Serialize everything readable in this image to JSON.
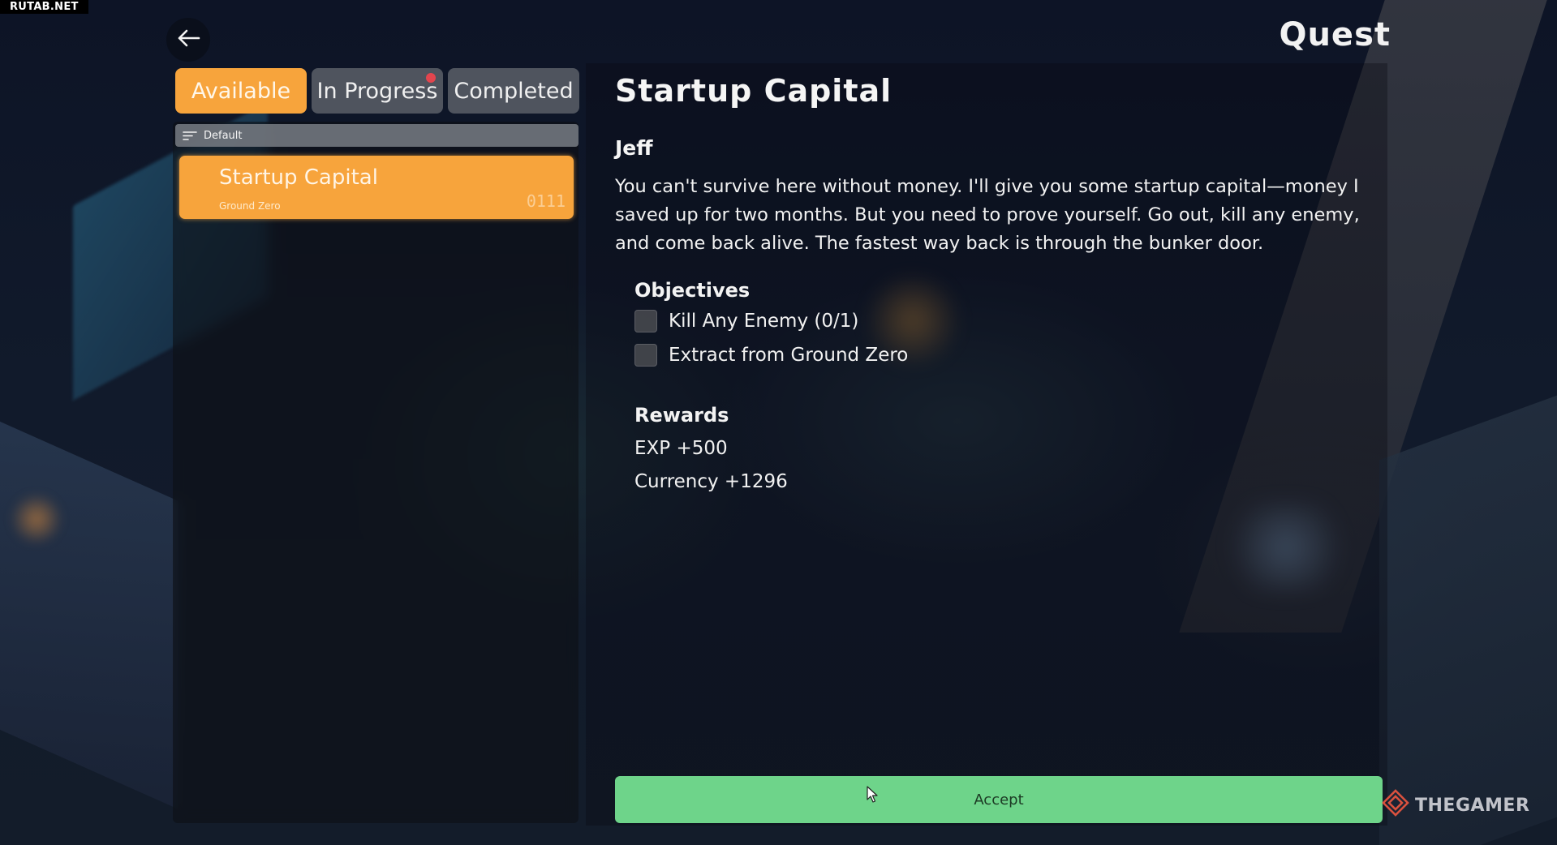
{
  "watermark": "RUTAB.NET",
  "header": {
    "title": "Quest"
  },
  "tabs": [
    {
      "label": "Available",
      "active": true
    },
    {
      "label": "In Progress",
      "active": false,
      "has_notification": true
    },
    {
      "label": "Completed",
      "active": false
    }
  ],
  "sort": {
    "label": "Default"
  },
  "quest_list": [
    {
      "name": "Startup Capital",
      "location": "Ground Zero",
      "code": "0111",
      "selected": true
    }
  ],
  "detail": {
    "title": "Startup Capital",
    "giver": "Jeff",
    "description": "You can't survive here without money. I'll give you some startup capital—money I saved up for two months. But you need to prove yourself. Go out, kill any enemy, and come back alive. The fastest way back is through the bunker door.",
    "objectives_heading": "Objectives",
    "objectives": [
      {
        "label": "Kill Any Enemy (0/1)",
        "done": false
      },
      {
        "label": "Extract from Ground Zero",
        "done": false
      }
    ],
    "rewards_heading": "Rewards",
    "rewards": [
      "EXP +500",
      "Currency +1296"
    ],
    "accept_label": "Accept"
  },
  "brand": "THEGAMER",
  "colors": {
    "accent_orange": "#f7a43c",
    "accept_green": "#6ed48a",
    "notification_red": "#e2454e"
  }
}
